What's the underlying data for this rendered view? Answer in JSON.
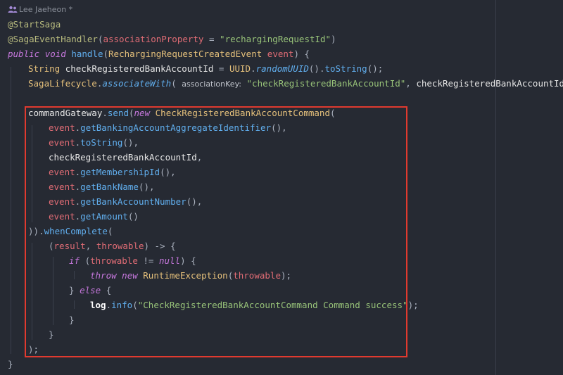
{
  "author": "Lee Jaeheon *",
  "code": {
    "ann_start_saga": "@StartSaga",
    "ann_handler": "@SagaEventHandler",
    "assoc_prop_name": "associationProperty",
    "assoc_prop_value": "\"rechargingRequestId\"",
    "kw_public": "public",
    "kw_void": "void",
    "method_handle": "handle",
    "event_type": "RechargingRequestCreatedEvent",
    "event_param": "event",
    "type_string": "String",
    "var_check_id": "checkRegisteredBankAccountId",
    "uuid": "UUID",
    "random_uuid": "randomUUID",
    "to_string": "toString",
    "saga_lifecycle": "SagaLifecycle",
    "associate_with": "associateWith",
    "association_key_hint": "associationKey:",
    "check_id_string": "\"checkRegisteredBankAccountId\"",
    "command_gateway": "commandGateway",
    "send": "send",
    "kw_new": "new",
    "command_class": "CheckRegisteredBankAccountCommand",
    "get_aggregate_id": "getBankingAccountAggregateIdentifier",
    "get_membership_id": "getMembershipId",
    "get_bank_name": "getBankName",
    "get_bank_account_number": "getBankAccountNumber",
    "get_amount": "getAmount",
    "when_complete": "whenComplete",
    "result": "result",
    "throwable": "throwable",
    "kw_if": "if",
    "kw_null": "null",
    "kw_throw": "throw",
    "runtime_exception": "RuntimeException",
    "kw_else": "else",
    "log": "log",
    "info": "info",
    "success_message": "\"CheckRegisteredBankAccountCommand Command success\""
  },
  "colors": {
    "background": "#262a33",
    "highlight_box": "#e03a2f",
    "keyword": "#c678dd",
    "function": "#61afef",
    "string": "#98c379",
    "type": "#e5c07b",
    "parameter": "#e06c75"
  }
}
